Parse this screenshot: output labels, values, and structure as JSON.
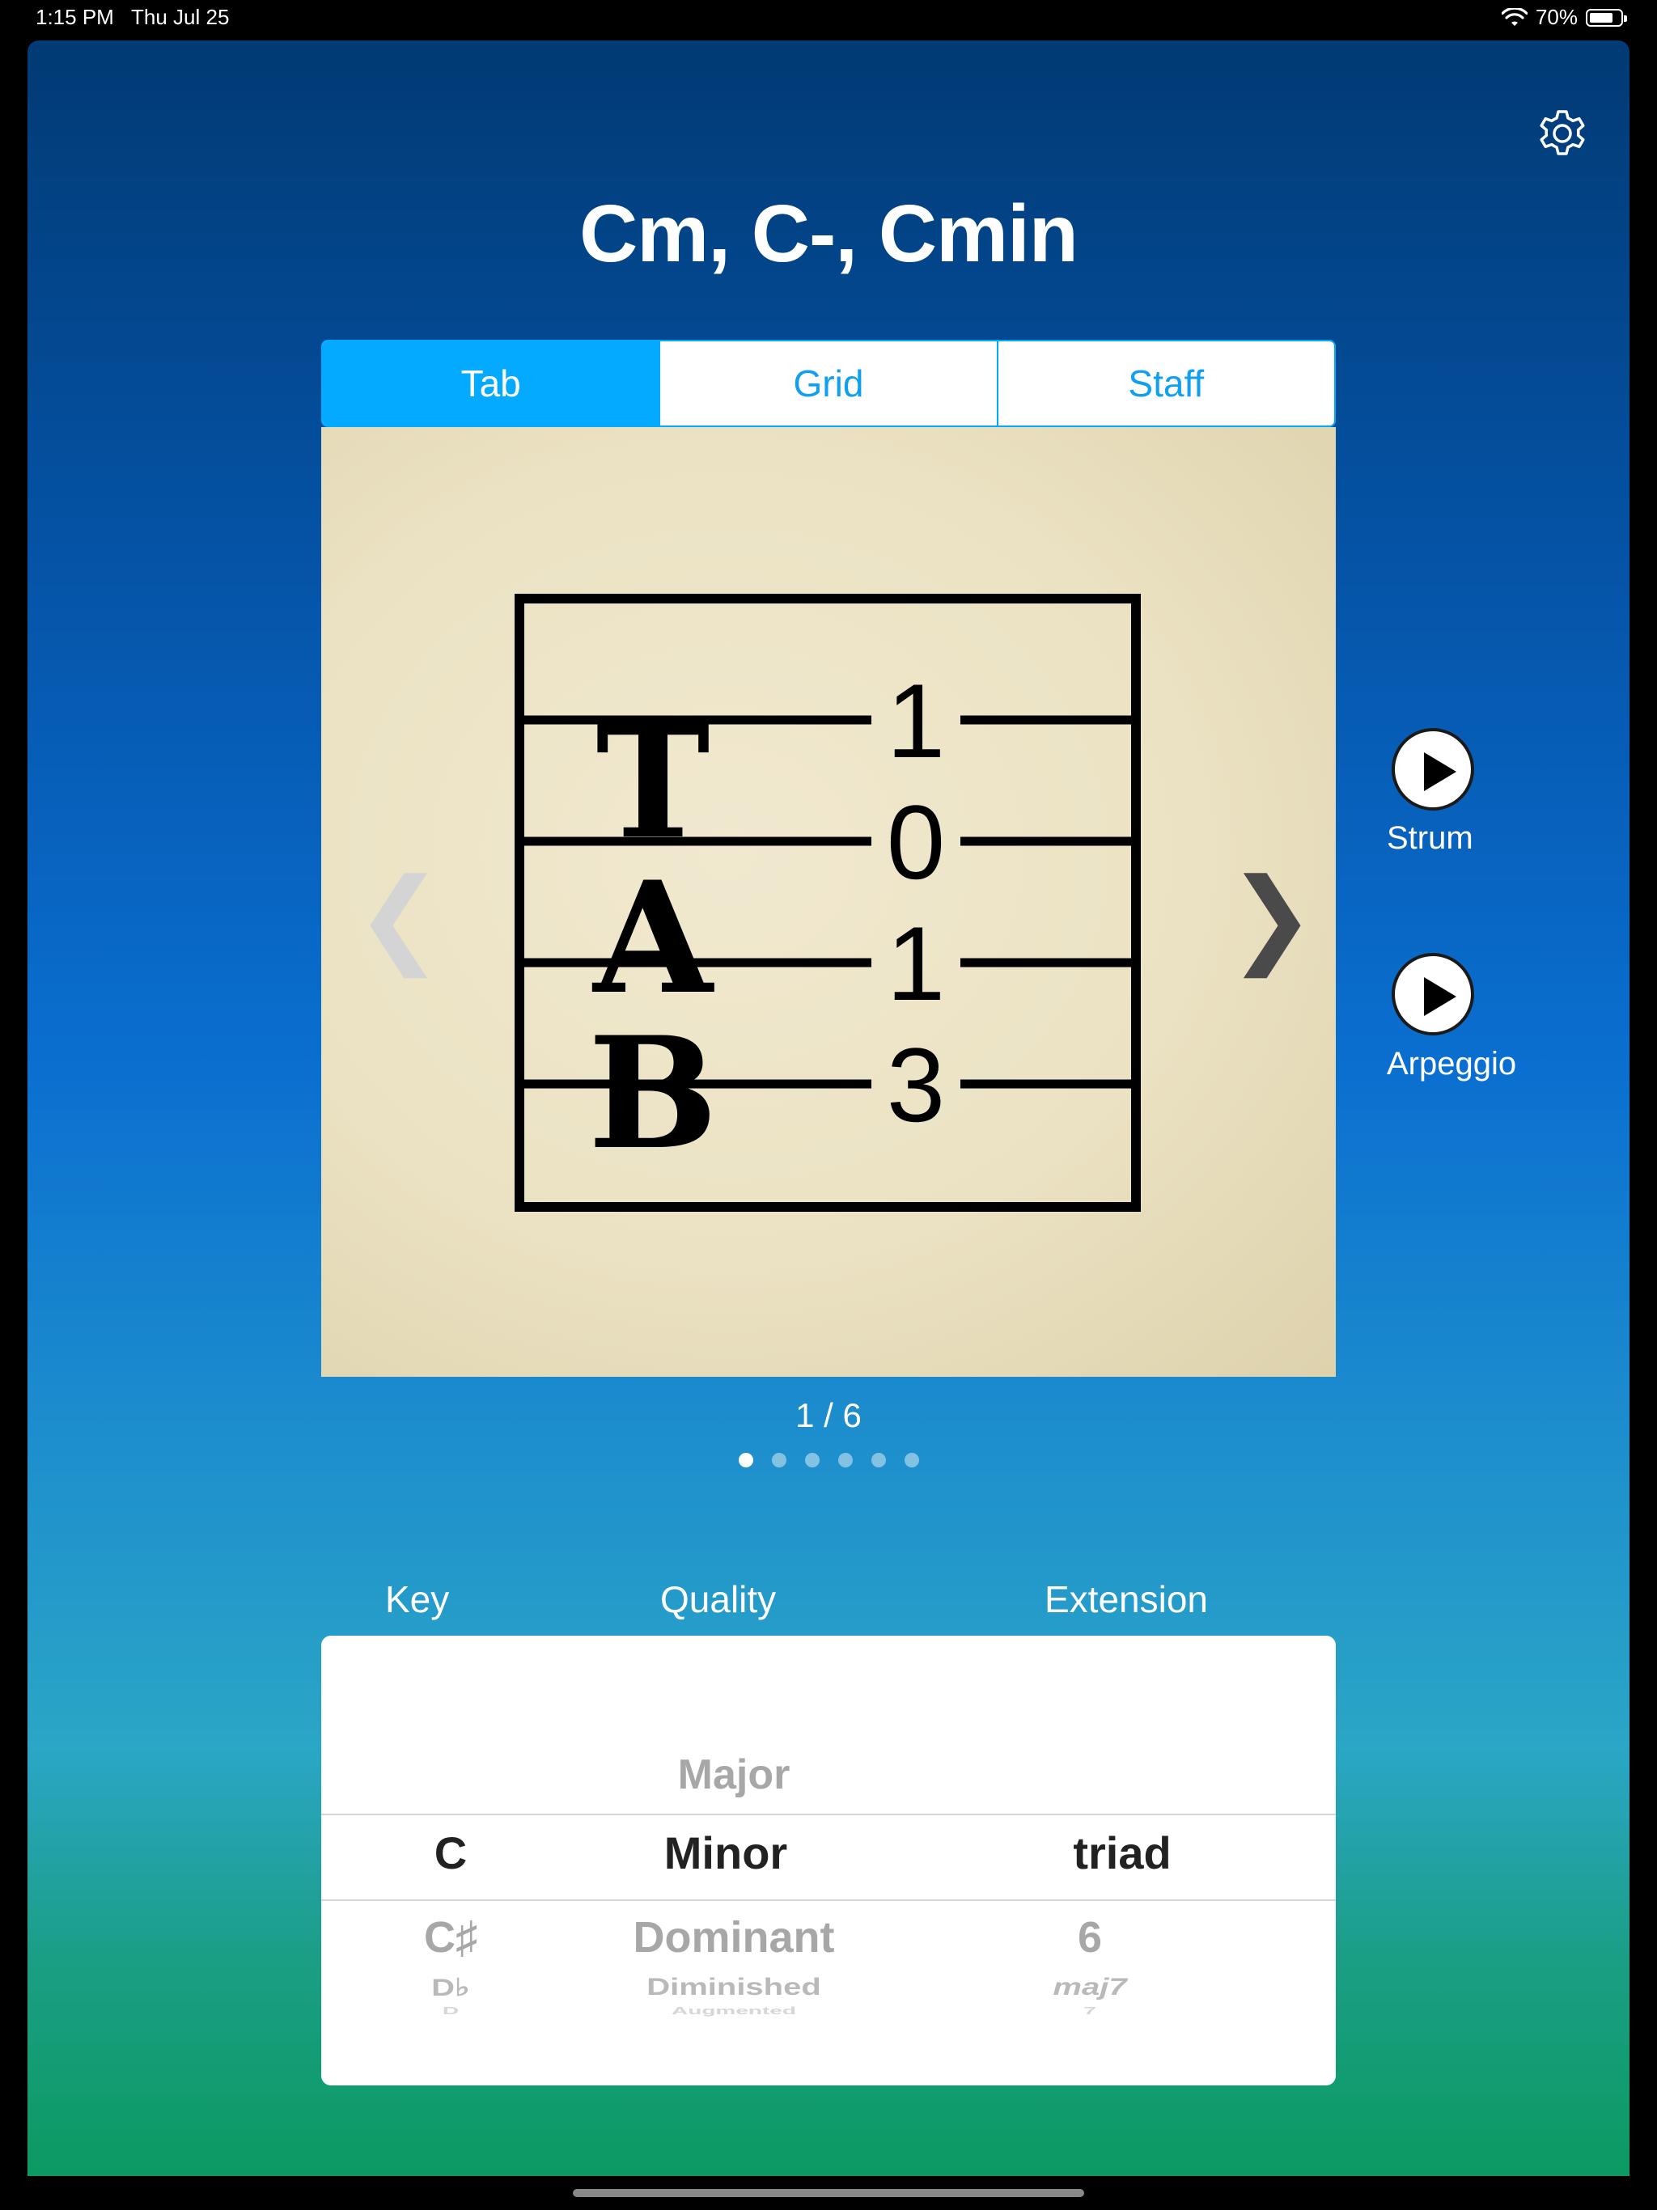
{
  "status_bar": {
    "time": "1:15 PM",
    "date": "Thu Jul 25",
    "battery": "70%"
  },
  "chord": {
    "title": "Cm, C-, Cmin"
  },
  "tabs": [
    {
      "label": "Tab",
      "active": true
    },
    {
      "label": "Grid",
      "active": false
    },
    {
      "label": "Staff",
      "active": false
    }
  ],
  "tab_diagram": {
    "header_letters": [
      "T",
      "A",
      "B"
    ],
    "string_frets": [
      "1",
      "0",
      "1",
      "3"
    ]
  },
  "navigation": {
    "prev": "❮",
    "next": "❯"
  },
  "pager": {
    "text": "1 / 6",
    "current": 1,
    "total": 6
  },
  "play": {
    "strum_label": "Strum",
    "arpeggio_label": "Arpeggio"
  },
  "picker": {
    "column_labels": {
      "key": "Key",
      "quality": "Quality",
      "extension": "Extension"
    },
    "key": {
      "selected": "C",
      "below": [
        "C♯",
        "D♭",
        "D"
      ]
    },
    "quality": {
      "above": "Major",
      "selected": "Minor",
      "below": [
        "Dominant",
        "Diminished",
        "Augmented"
      ]
    },
    "extension": {
      "selected": "triad",
      "below": [
        "6",
        "maj7",
        "7"
      ]
    }
  },
  "colors": {
    "accent": "#04aaff",
    "paper": "#ece3c6",
    "gradient_top": "#013a74",
    "gradient_bottom": "#0c9a62"
  },
  "icons": {
    "settings": "gear-icon",
    "play": "play-icon"
  }
}
